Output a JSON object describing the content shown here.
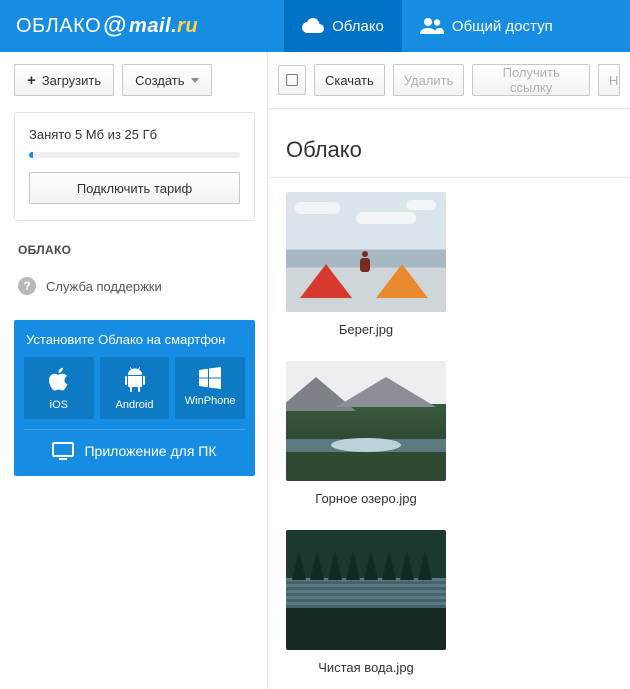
{
  "brand": {
    "obl": "ОБЛАКО",
    "at": "@",
    "mail": "mail",
    "dot": ".",
    "ru": "ru"
  },
  "nav": {
    "cloud": "Облако",
    "shared": "Общий доступ"
  },
  "sidebar": {
    "upload": "Загрузить",
    "create": "Создать",
    "storage_text": "Занято 5 Мб из 25 Гб",
    "tariff": "Подключить тариф",
    "heading": "ОБЛАКО",
    "support": "Служба поддержки",
    "promo_title": "Установите Облако на смартфон",
    "platforms": {
      "ios": "iOS",
      "android": "Android",
      "winphone": "WinPhone"
    },
    "pc_app": "Приложение для ПК"
  },
  "toolbar": {
    "download": "Скачать",
    "delete": "Удалить",
    "getlink": "Получить ссылку",
    "cut": "Н"
  },
  "page": {
    "title": "Облако"
  },
  "files": [
    {
      "name": "Берег.jpg"
    },
    {
      "name": "Горное озеро.jpg"
    },
    {
      "name": "Чистая вода.jpg"
    }
  ]
}
